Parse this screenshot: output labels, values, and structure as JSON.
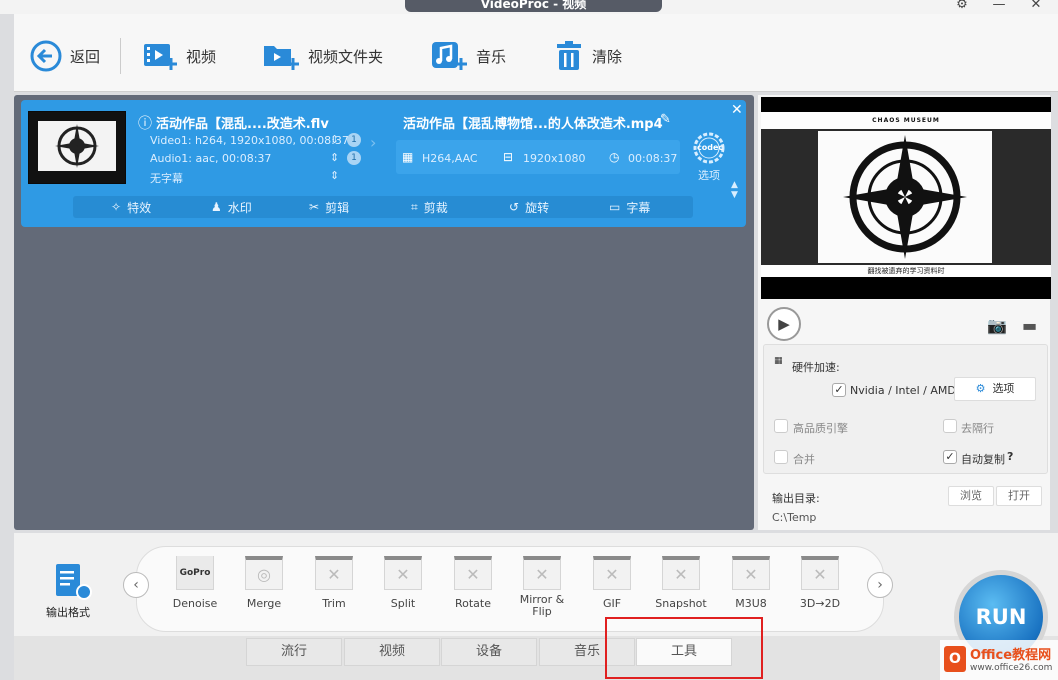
{
  "window": {
    "title": "VideoProc - 视频",
    "settings_icon": "gear-icon",
    "minimize": "—",
    "close": "✕"
  },
  "toolbar": {
    "back": "返回",
    "video": "视频",
    "video_folder": "视频文件夹",
    "music": "音乐",
    "clear": "清除",
    "accent": "#2a8ad8"
  },
  "file": {
    "source_name": "活动作品【混乱....改造术.flv",
    "video_track": "Video1: h264, 1920x1080, 00:08:37",
    "audio_track": "Audio1: aac, 00:08:37",
    "subtitle": "无字幕",
    "badge1": "1",
    "badge2": "1",
    "output_name": "活动作品【混乱博物馆...的人体改造术.mp4",
    "codec": "H264,AAC",
    "resolution": "1920x1080",
    "duration": "00:08:37",
    "codec_button": "codec",
    "options_label": "选项",
    "edit": {
      "effects": "特效",
      "watermark": "水印",
      "cut": "剪辑",
      "crop": "剪裁",
      "rotate": "旋转",
      "subtitle": "字幕"
    }
  },
  "preview": {
    "header": "CHAOS MUSEUM",
    "caption": "翻找被遗弃的学习资料时"
  },
  "settings": {
    "hw_accel": "硬件加速:",
    "nvidia": "Nvidia / Intel / AMD",
    "options": "选项",
    "hq_engine": "高品质引擎",
    "deinterlace": "去隔行",
    "merge": "合并",
    "auto_copy": "自动复制",
    "help": "?",
    "output_dir_label": "输出目录:",
    "output_dir": "C:\\Temp",
    "browse": "浏览",
    "open": "打开"
  },
  "bottom": {
    "output_format": "输出格式",
    "tools": [
      "Denoise",
      "Merge",
      "Trim",
      "Split",
      "Rotate",
      "Mirror &\nFlip",
      "GIF",
      "Snapshot",
      "M3U8",
      "3D→2D"
    ],
    "gopro": "GoPro",
    "tabs": [
      "流行",
      "视频",
      "设备",
      "音乐",
      "工具"
    ],
    "run": "RUN"
  },
  "watermark": {
    "brand": "Office教程网",
    "url": "www.office26.com"
  }
}
